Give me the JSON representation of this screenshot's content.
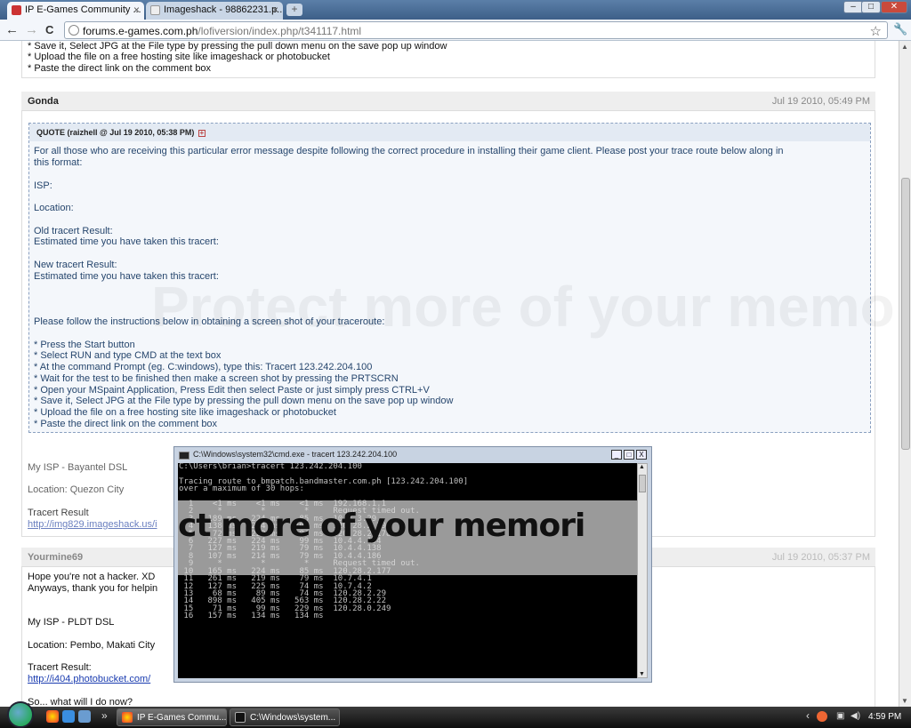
{
  "browser": {
    "tabs": [
      {
        "title": "IP E-Games Community ...",
        "close": "×"
      },
      {
        "title": "Imageshack - 98862231.p...",
        "close": "×"
      }
    ],
    "new_tab": "+",
    "window_controls": {
      "minimize": "–",
      "maximize": "□",
      "close": "✕"
    },
    "nav": {
      "back": "←",
      "forward": "→",
      "reload": "C"
    },
    "url_host": "forums.e-games.com.ph",
    "url_path": "/lofiversion/index.php/t341117.html",
    "star": "☆",
    "wrench": "🔧"
  },
  "top_fragment": [
    "* Save it, Select JPG at the File type by pressing the pull down menu on the save pop up window",
    "* Upload the file on a free hosting site like imageshack or photobucket",
    "* Paste the direct link on the comment box"
  ],
  "post1": {
    "author": "Gonda",
    "date": "Jul 19 2010, 05:49 PM",
    "quote_title": "QUOTE (raizhell @ Jul 19 2010, 05:38 PM)",
    "quote_plus": "+",
    "quote_lines": [
      "For all those who are receiving this particular error message despite following the correct procedure in installing their game client. Please post your trace route below along in",
      "this format:",
      "ISP:",
      "Location:",
      "Old tracert Result:",
      "Estimated time you have taken this tracert:",
      "New tracert Result:",
      "Estimated time you have taken this tracert:",
      "Please follow the instructions below in obtaining a screen shot of your traceroute:",
      "* Press the Start button",
      "* Select RUN and type CMD at the text box",
      "* At the command Prompt (eg. C:windows), type this: Tracert 123.242.204.100",
      "* Wait for the test to be finished then make a screen shot by pressing the PRTSCRN",
      "* Open your MSpaint Application, Press Edit then select Paste or just simply press CTRL+V",
      "* Save it, Select JPG at the File type by pressing the pull down menu on the save pop up window",
      "* Upload the file on a free hosting site like imageshack or photobucket",
      "* Paste the direct link on the comment box"
    ],
    "isp": "My ISP - Bayantel DSL",
    "location": "Location: Quezon City",
    "tracert_label": "Tracert Result",
    "link": "http://img829.imageshack.us/i"
  },
  "post2": {
    "author": "Yourmine69",
    "date": "Jul 19 2010, 05:37 PM",
    "lines": [
      "Hope you're not a hacker. XD",
      "Anyways, thank you for helpin",
      "My ISP - PLDT DSL",
      "Location: Pembo, Makati City",
      "Tracert Result:"
    ],
    "link": "http://i404.photobucket.com/",
    "last_line": "So... what will I do now?"
  },
  "watermark": "Protect more of your memories",
  "cmd": {
    "title": "C:\\Windows\\system32\\cmd.exe - tracert  123.242.204.100",
    "buttons": {
      "min": "_",
      "max": "□",
      "close": "X"
    },
    "overlay_text": "ct more of your memori",
    "lines": [
      "C:\\Users\\brian>tracert 123.242.204.100",
      "",
      "Tracing route to bmpatch.bandmaster.com.ph [123.242.204.100]",
      "over a maximum of 30 hops:",
      "",
      "  1    <1 ms    <1 ms    <1 ms  192.168.1.1",
      "  2     *        *        *     Request timed out.",
      "  3   189 ms   224 ms    85 ms  10.7.3.29",
      "  4   138 ms   224 ms   105 ms  120.28.2.29",
      "  5    72 ms   229 ms    84 ms  120.28.2.178",
      "  6   227 ms   224 ms    99 ms  10.4.4.194",
      "  7   127 ms   219 ms    79 ms  10.4.4.138",
      "  8   107 ms   214 ms    79 ms  10.4.4.186",
      "  9     *        *        *     Request timed out.",
      " 10   165 ms   224 ms    85 ms  120.28.2.177",
      " 11   261 ms   219 ms    79 ms  10.7.4.1",
      " 12   127 ms   225 ms    74 ms  10.7.4.2",
      " 13    68 ms    89 ms    74 ms  120.28.2.29",
      " 14   898 ms   405 ms   563 ms  120.28.2.22",
      " 15    71 ms    99 ms   229 ms  120.28.0.249",
      " 16   157 ms   134 ms   134 ms"
    ]
  },
  "taskbar": {
    "quick_launch_more": "»",
    "buttons": [
      "IP E-Games Commu...",
      "C:\\Windows\\system..."
    ],
    "tray_arrow": "‹",
    "clock": "4:59 PM"
  },
  "colors": {
    "accent": "#26466d",
    "link": "#1a3cb0",
    "taskbar": "#1a1a1a"
  }
}
